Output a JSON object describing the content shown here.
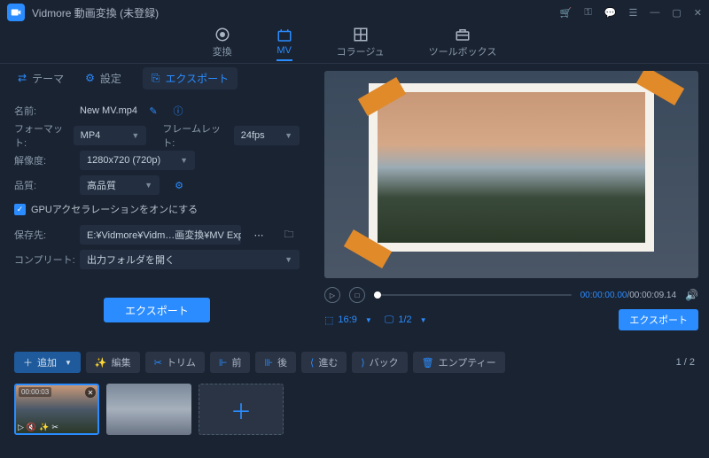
{
  "app": {
    "title": "Vidmore 動画変換 (未登録)"
  },
  "mainTabs": {
    "convert": "変換",
    "mv": "MV",
    "collage": "コラージュ",
    "toolbox": "ツールボックス"
  },
  "subTabs": {
    "theme": "テーマ",
    "settings": "設定",
    "export": "エクスポート"
  },
  "form": {
    "nameLabel": "名前:",
    "nameValue": "New MV.mp4",
    "formatLabel": "フォーマット:",
    "formatValue": "MP4",
    "framerateLabel": "フレームレット:",
    "framerateValue": "24fps",
    "resolutionLabel": "解像度:",
    "resolutionValue": "1280x720 (720p)",
    "qualityLabel": "品質:",
    "qualityValue": "高品質",
    "gpuAccel": "GPUアクセラレーションをオンにする",
    "savePathLabel": "保存先:",
    "savePathValue": "E:¥Vidmore¥Vidm…画変換¥MV Exported",
    "completeLabel": "コンプリート:",
    "completeValue": "出力フォルダを開く",
    "exportBtn": "エクスポート"
  },
  "player": {
    "currentTime": "00:00:00.00",
    "duration": "00:00:09.14",
    "aspectRatio": "16:9",
    "pageDisplay": "1/2",
    "exportBtn": "エクスポート"
  },
  "toolbar": {
    "add": "追加",
    "edit": "編集",
    "trim": "トリム",
    "before": "前",
    "after": "後",
    "forward": "進む",
    "back": "バック",
    "empty": "エンプティー",
    "pageInd": "1 / 2"
  },
  "clips": [
    {
      "label": "00:00:03"
    },
    {
      "label": ""
    }
  ]
}
